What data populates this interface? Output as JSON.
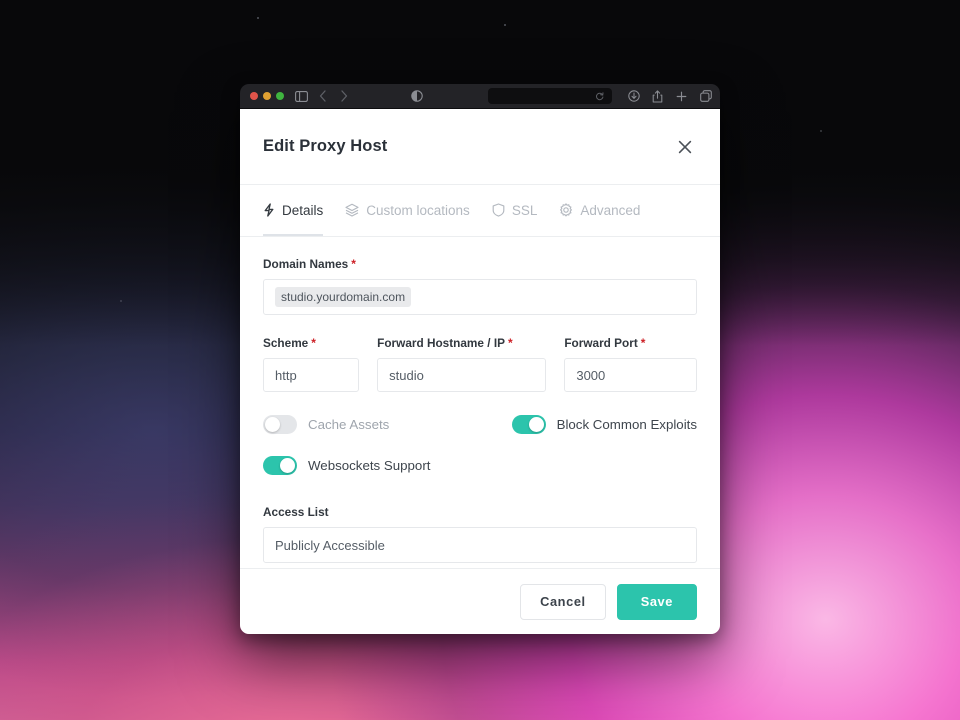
{
  "browser": {
    "traffic_lights": [
      "close",
      "minimize",
      "zoom"
    ],
    "sidebar_toggle_icon": "sidebar-icon",
    "back_icon": "chevron-left-icon",
    "forward_icon": "chevron-right-icon",
    "appearance_icon": "half-circle-contrast-icon",
    "url_value": "",
    "url_placeholder": "",
    "reload_icon": "reload-icon",
    "downloads_icon": "download-icon",
    "share_icon": "share-icon",
    "new_tab_icon": "plus-icon",
    "tab_overview_icon": "tab-overview-icon"
  },
  "modal": {
    "title": "Edit Proxy Host",
    "close_icon": "close-icon",
    "tabs": [
      {
        "label": "Details",
        "icon": "bolt-icon",
        "active": true
      },
      {
        "label": "Custom locations",
        "icon": "layers-icon",
        "active": false
      },
      {
        "label": "SSL",
        "icon": "shield-icon",
        "active": false
      },
      {
        "label": "Advanced",
        "icon": "gear-icon",
        "active": false
      }
    ],
    "fields": {
      "domain_names": {
        "label": "Domain Names",
        "required": true,
        "tags": [
          "studio.yourdomain.com"
        ]
      },
      "scheme": {
        "label": "Scheme",
        "required": true,
        "value": "http"
      },
      "forward_hostname": {
        "label": "Forward Hostname / IP",
        "required": true,
        "value": "studio"
      },
      "forward_port": {
        "label": "Forward Port",
        "required": true,
        "value": "3000"
      },
      "access_list": {
        "label": "Access List",
        "required": false,
        "value": "Publicly Accessible"
      }
    },
    "toggles": [
      {
        "label": "Cache Assets",
        "on": false
      },
      {
        "label": "Block Common Exploits",
        "on": true
      },
      {
        "label": "Websockets Support",
        "on": true
      }
    ],
    "footer": {
      "cancel_label": "Cancel",
      "save_label": "Save"
    }
  },
  "colors": {
    "accent_teal": "#2cc4ac",
    "required_red": "#cd2026",
    "text_dark": "#2b3139",
    "text_muted": "#9fa5ad",
    "border": "#e6e8eb"
  }
}
